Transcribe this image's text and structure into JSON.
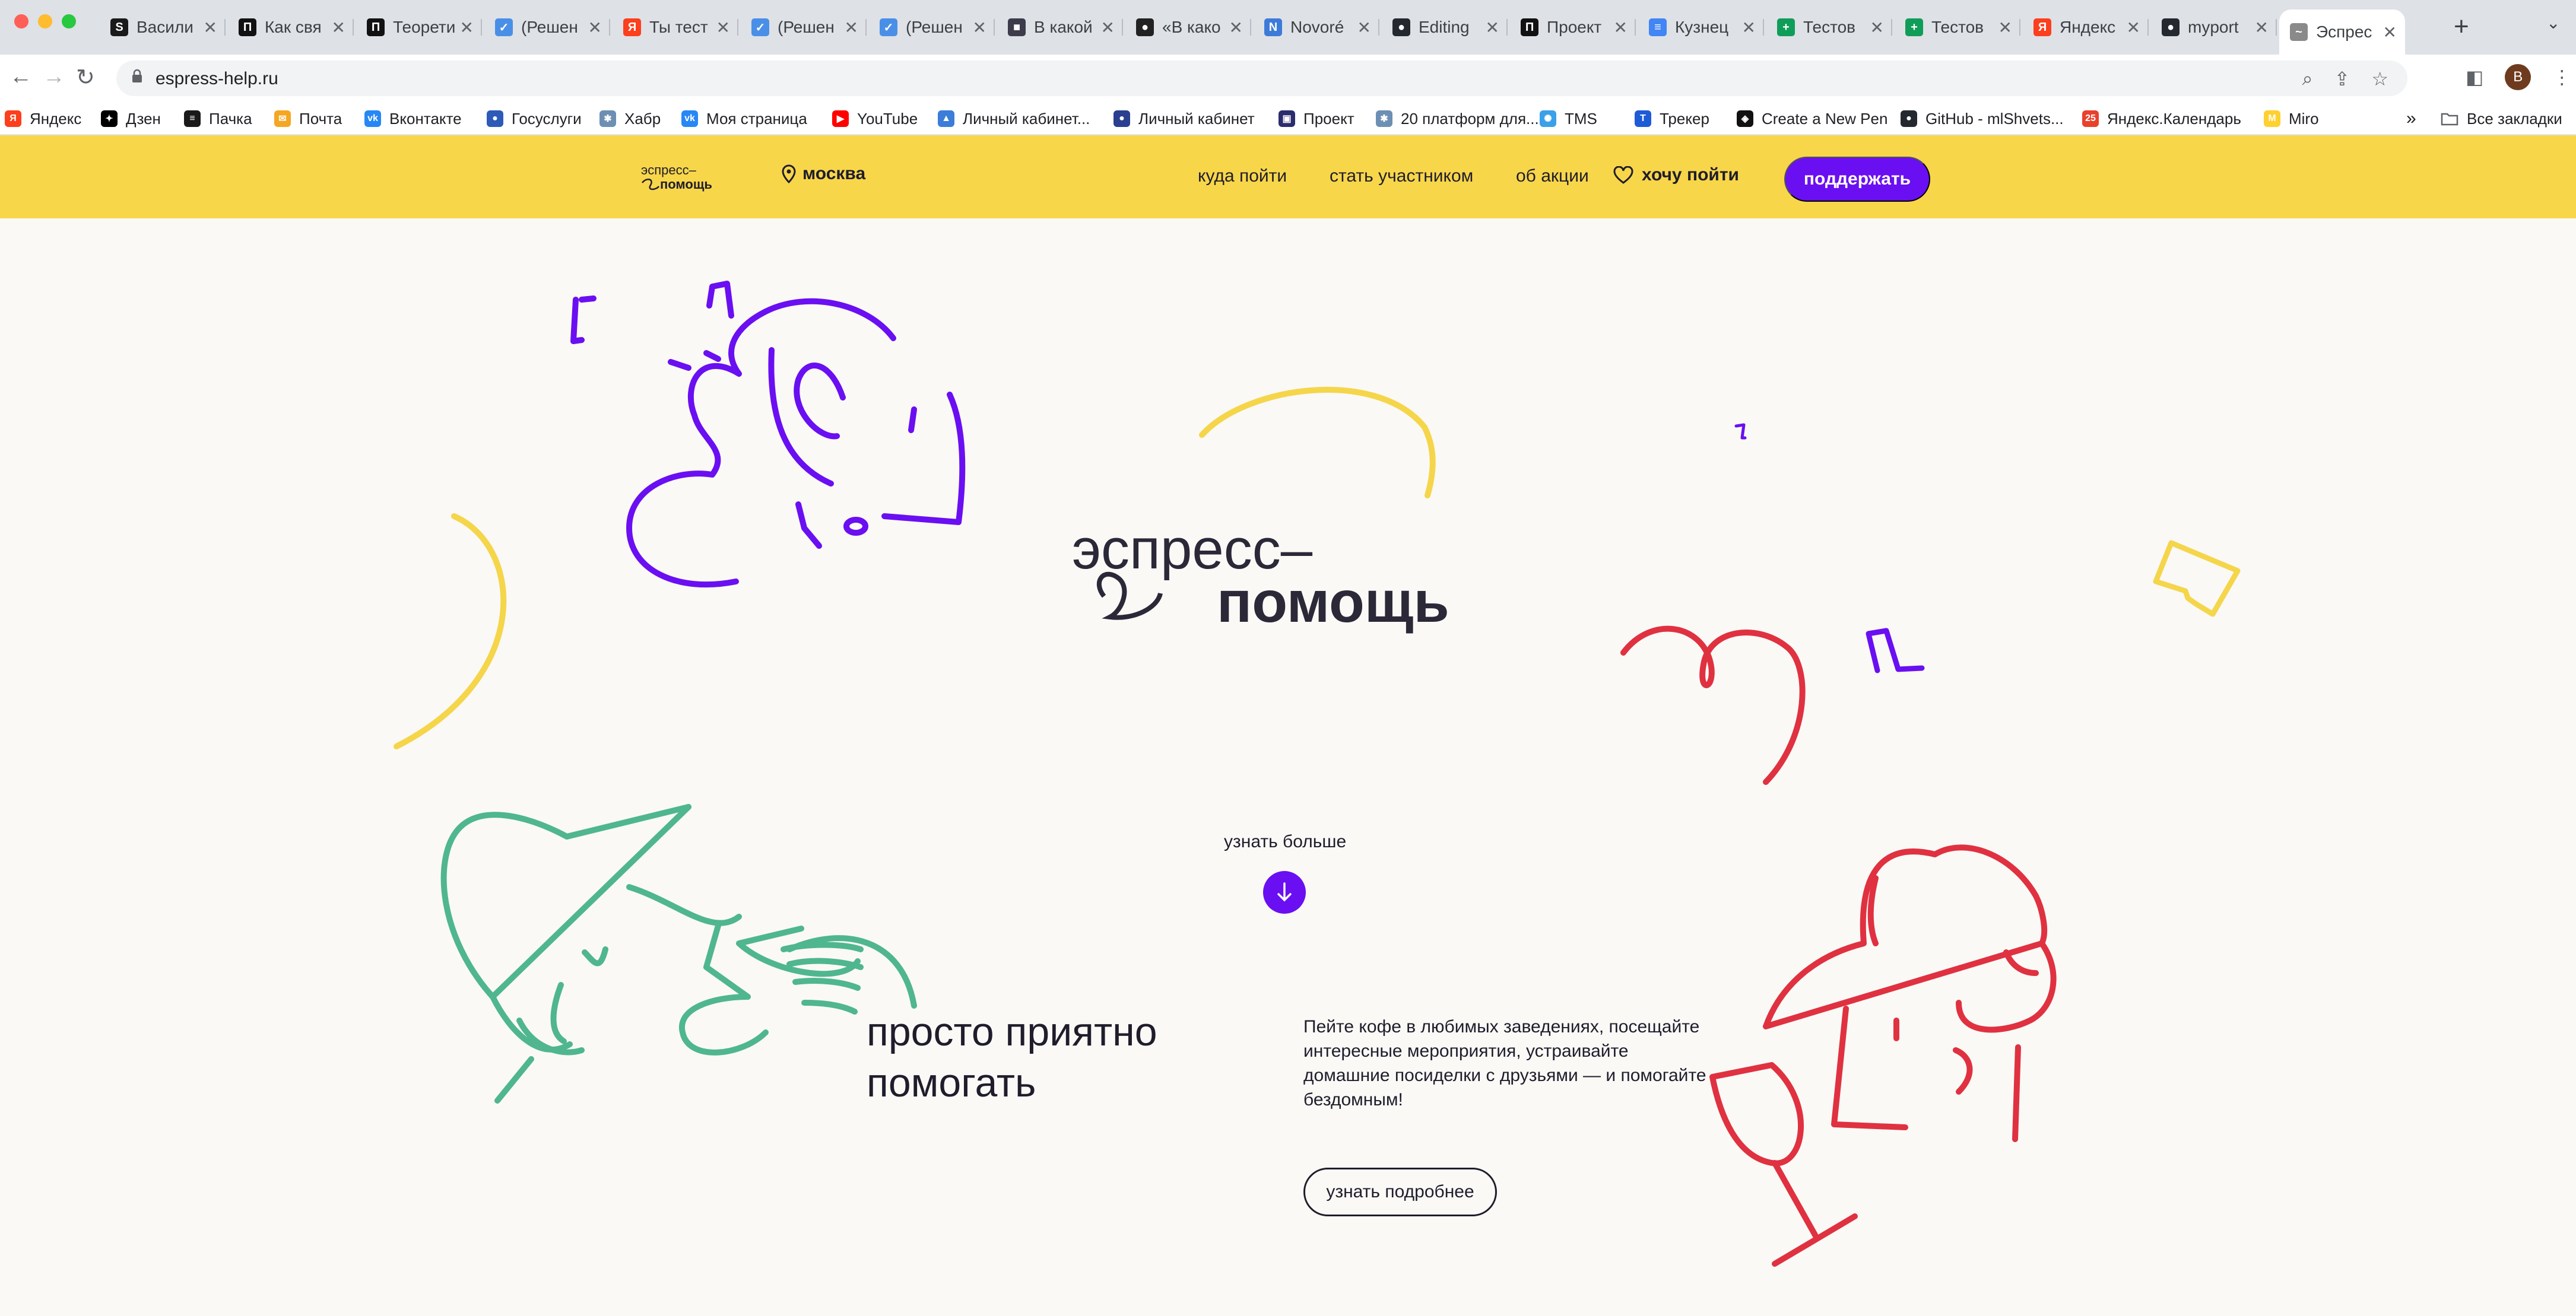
{
  "browser": {
    "tabs": [
      {
        "title": "Васили",
        "color": "#1a1a1a",
        "glyph": "S"
      },
      {
        "title": "Как свя",
        "color": "#111111",
        "glyph": "П"
      },
      {
        "title": "Теорети",
        "color": "#111111",
        "glyph": "П"
      },
      {
        "title": "(Решен",
        "color": "#4a8fe7",
        "glyph": "✓"
      },
      {
        "title": "Ты тест",
        "color": "#fc3f1d",
        "glyph": "Я"
      },
      {
        "title": "(Решен",
        "color": "#4a8fe7",
        "glyph": "✓"
      },
      {
        "title": "(Решен",
        "color": "#4a8fe7",
        "glyph": "✓"
      },
      {
        "title": "В какой",
        "color": "#3c3c4a",
        "glyph": "■"
      },
      {
        "title": "«В како",
        "color": "#222222",
        "glyph": "●"
      },
      {
        "title": "Novoré",
        "color": "#3d7bd9",
        "glyph": "N"
      },
      {
        "title": "Editing",
        "color": "#24292f",
        "glyph": "●"
      },
      {
        "title": "Проект",
        "color": "#111111",
        "glyph": "П"
      },
      {
        "title": "Кузнец",
        "color": "#4285f4",
        "glyph": "≡"
      },
      {
        "title": "Тестов",
        "color": "#0f9d58",
        "glyph": "+"
      },
      {
        "title": "Тестов",
        "color": "#0f9d58",
        "glyph": "+"
      },
      {
        "title": "Яндекс",
        "color": "#fc3f1d",
        "glyph": "Я"
      },
      {
        "title": "myport",
        "color": "#24292f",
        "glyph": "●"
      },
      {
        "title": "Эспрес",
        "color": "#8a8a8a",
        "glyph": "~",
        "active": true
      }
    ],
    "url": "espress-help.ru",
    "profile_initial": "B"
  },
  "bookmarks": {
    "items": [
      {
        "label": "Яндекс",
        "color": "#fc3f1d",
        "glyph": "Я"
      },
      {
        "label": "Дзен",
        "color": "#000000",
        "glyph": "✦"
      },
      {
        "label": "Пачка",
        "color": "#1a1a1a",
        "glyph": "≡"
      },
      {
        "label": "Почта",
        "color": "#f5a623",
        "glyph": "✉"
      },
      {
        "label": "Вконтакте",
        "color": "#2787f5",
        "glyph": "vk"
      },
      {
        "label": "Госуслуги",
        "color": "#2d5bb7",
        "glyph": "●"
      },
      {
        "label": "Хабр",
        "color": "#6d8fb3",
        "glyph": "✱"
      },
      {
        "label": "Моя страница",
        "color": "#2787f5",
        "glyph": "vk"
      },
      {
        "label": "YouTube",
        "color": "#ff0000",
        "glyph": "▶"
      },
      {
        "label": "Личный кабинет...",
        "color": "#3b7dd8",
        "glyph": "▲"
      },
      {
        "label": "Личный кабинет",
        "color": "#2a3f8f",
        "glyph": "●"
      },
      {
        "label": "Проект",
        "color": "#2b2d6e",
        "glyph": "▣"
      },
      {
        "label": "20 платформ для...",
        "color": "#6d8fb3",
        "glyph": "✱"
      },
      {
        "label": "TMS",
        "color": "#3aa0e8",
        "glyph": "✺"
      },
      {
        "label": "Трекер",
        "color": "#1e5bd6",
        "glyph": "T"
      },
      {
        "label": "Create a New Pen",
        "color": "#111111",
        "glyph": "◈"
      },
      {
        "label": "GitHub - mlShvets...",
        "color": "#24292f",
        "glyph": "●"
      },
      {
        "label": "Яндекс.Календарь",
        "color": "#e8412c",
        "glyph": "25"
      },
      {
        "label": "Miro",
        "color": "#ffd02f",
        "glyph": "M"
      }
    ],
    "more": "»",
    "all_bookmarks": "Все закладки"
  },
  "site": {
    "logo_top": "эспресс–",
    "logo_bottom": "помощь",
    "city": "москва",
    "nav": [
      "куда пойти",
      "стать участником",
      "об акции"
    ],
    "favorites": "хочу пойти",
    "support": "поддержать"
  },
  "hero": {
    "logo_top": "эспресс–",
    "logo_bottom": "помощь",
    "learn_more": "узнать больше",
    "down_arrow": "↓",
    "headline_line1": "просто приятно",
    "headline_line2": "помогать",
    "description": "Пейте кофе в любимых заведениях, посещайте интересные мероприятия, устраивайте домашние посиделки с друзьями — и помогайте бездомным!",
    "details_button": "узнать подробнее"
  },
  "colors": {
    "brand_yellow": "#f8d64a",
    "brand_purple": "#6a0ff2",
    "doodle_green": "#4fb690",
    "doodle_red": "#e03140",
    "doodle_yellow": "#f5d54a",
    "text_dark": "#1f1d2b"
  }
}
